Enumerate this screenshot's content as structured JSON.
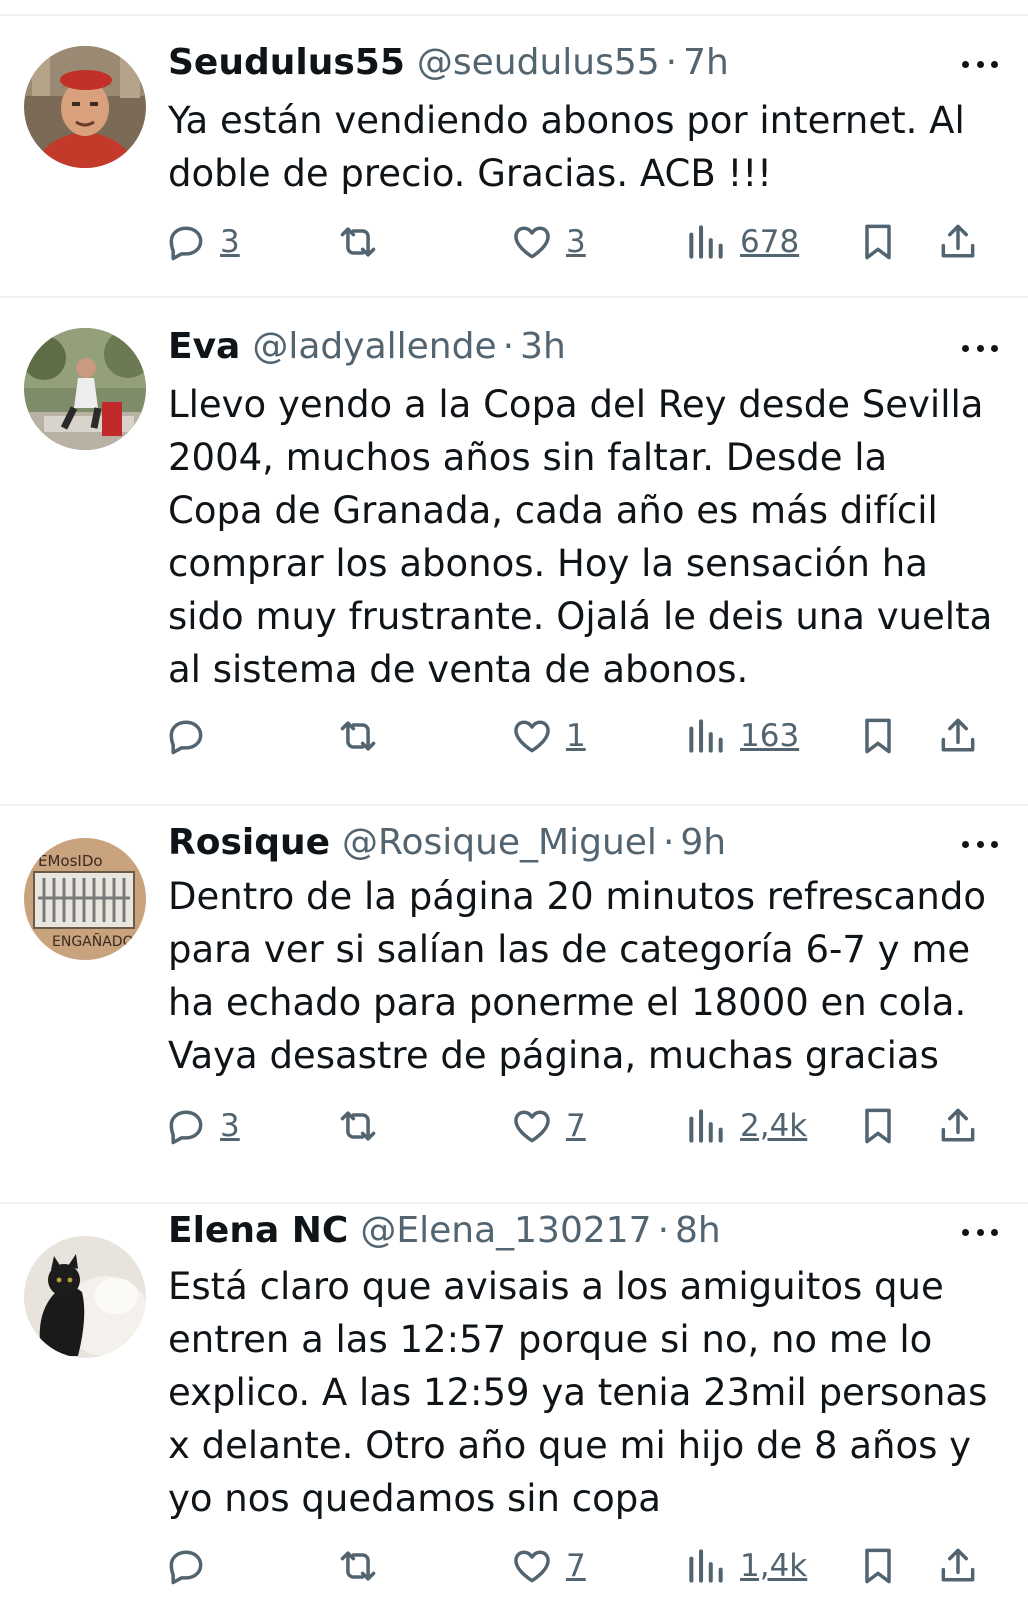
{
  "tweets": [
    {
      "name": "Seudulus55",
      "handle": "@seudulus55",
      "separator": "·",
      "time": "7h",
      "text": "Ya están vendiendo abonos por internet. Al\ndoble de precio. Gracias. ACB !!!",
      "replies": "3",
      "retweets": "",
      "likes": "3",
      "views": "678"
    },
    {
      "name": "Eva",
      "handle": "@ladyallende",
      "separator": "·",
      "time": "3h",
      "text": "Llevo yendo a la Copa del Rey desde Sevilla\n2004, muchos años sin faltar. Desde la\nCopa de Granada, cada año es más difícil\ncomprar los abonos. Hoy la sensación ha\nsido muy frustrante. Ojalá le deis una vuelta\nal sistema de venta de abonos.",
      "replies": "",
      "retweets": "",
      "likes": "1",
      "views": "163"
    },
    {
      "name": "Rosique",
      "handle": "@Rosique_Miguel",
      "separator": "·",
      "time": "9h",
      "text": "Dentro de la página 20 minutos refrescando\npara ver si salían las de categoría 6-7 y me\nha echado para ponerme el 18000 en cola.\nVaya desastre de página, muchas gracias",
      "replies": "3",
      "retweets": "",
      "likes": "7",
      "views": "2,4k",
      "avatar_text_top": "EMosIDo",
      "avatar_text_bottom": "ENGAÑADO"
    },
    {
      "name": "Elena NC",
      "handle": "@Elena_130217",
      "separator": "·",
      "time": "8h",
      "text": "Está claro que avisais a los amiguitos que\nentren a las 12:57 porque si no, no me lo\nexplico. A las 12:59 ya tenia 23mil personas\nx delante. Otro año que mi hijo de 8 años y\nyo nos quedamos sin copa",
      "replies": "",
      "retweets": "",
      "likes": "7",
      "views": "1,4k"
    }
  ],
  "icons": {
    "reply": "reply-icon",
    "retweet": "retweet-icon",
    "like": "heart-icon",
    "views": "views-icon",
    "bookmark": "bookmark-icon",
    "share": "share-icon",
    "more": "more-icon"
  },
  "colors": {
    "text": "#0f1419",
    "secondary": "#536471",
    "divider": "#eff3f4"
  }
}
